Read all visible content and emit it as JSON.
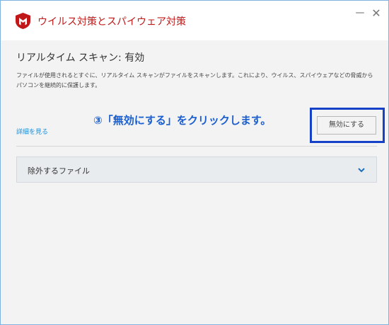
{
  "app": {
    "title": "ウイルス対策とスパイウェア対策",
    "brand_color": "#c01818"
  },
  "window_controls": {
    "minimize": "－",
    "close": "✕"
  },
  "page": {
    "title": "リアルタイム スキャン: 有効",
    "description": "ファイルが使用されるとすぐに、リアルタイム スキャンがファイルをスキャンします。これにより、ウイルス、スパイウェアなどの脅威からパソコンを継続的に保護します。",
    "details_link": "詳細を見る",
    "disable_button": "無効にする"
  },
  "annotation": {
    "text": "③「無効にする」をクリックします。",
    "color": "#1a5ed0",
    "box_color": "#1541c9"
  },
  "excluded_files": {
    "label": "除外するファイル",
    "expanded": false
  },
  "icons": {
    "logo": "mcafee-shield-icon",
    "chevron": "chevron-down-icon"
  }
}
